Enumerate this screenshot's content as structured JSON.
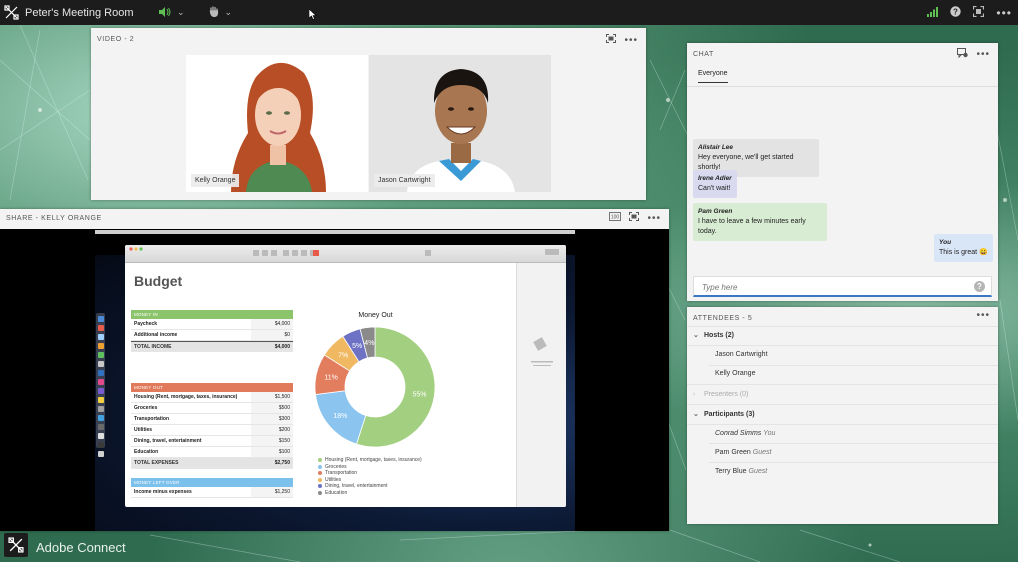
{
  "app": {
    "name": "Adobe Connect",
    "room_title": "Peter's Meeting Room"
  },
  "topbar": {
    "audio_icon": "speaker-icon",
    "raise_hand_icon": "hand-icon",
    "signal_icon": "signal-bars-icon",
    "help_icon": "help-icon",
    "fullscreen_icon": "fullscreen-icon",
    "more_icon": "more-icon"
  },
  "video_pod": {
    "title": "VIDEO - 2",
    "tiles": [
      {
        "name": "Kelly Orange"
      },
      {
        "name": "Jason Cartwright"
      }
    ]
  },
  "share_pod": {
    "title": "SHARE - KELLY ORANGE",
    "zoom_label": "100"
  },
  "budget": {
    "title": "Budget",
    "money_in": {
      "header": "MONEY IN",
      "rows": [
        {
          "label": "Paycheck",
          "value": "$4,000"
        },
        {
          "label": "Additional income",
          "value": "$0"
        }
      ],
      "total": {
        "label": "TOTAL INCOME",
        "value": "$4,000"
      }
    },
    "money_out": {
      "header": "MONEY OUT",
      "rows": [
        {
          "label": "Housing (Rent, mortgage, taxes, insurance)",
          "value": "$1,500"
        },
        {
          "label": "Groceries",
          "value": "$500"
        },
        {
          "label": "Transportation",
          "value": "$300"
        },
        {
          "label": "Utilities",
          "value": "$200"
        },
        {
          "label": "Dining, travel, entertainment",
          "value": "$150"
        },
        {
          "label": "Education",
          "value": "$100"
        }
      ],
      "total": {
        "label": "TOTAL EXPENSES",
        "value": "$2,750"
      }
    },
    "money_left": {
      "header": "MONEY LEFT OVER",
      "rows": [
        {
          "label": "Income minus expenses",
          "value": "$1,250"
        }
      ]
    }
  },
  "chart_data": {
    "type": "pie",
    "title": "Money Out",
    "donut": true,
    "categories": [
      "Housing (Rent, mortgage, taxes, insurance)",
      "Groceries",
      "Transportation",
      "Utilities",
      "Dining, travel, entertainment",
      "Education"
    ],
    "values": [
      55,
      18,
      11,
      7,
      5,
      4
    ],
    "labels": [
      "55%",
      "18%",
      "11%",
      "7%",
      "5%",
      "4%"
    ],
    "colors": [
      "#a3cf80",
      "#8ac4ef",
      "#e27d5e",
      "#f0b861",
      "#6e72c4",
      "#8a8a8a"
    ],
    "legend": "bottom"
  },
  "chat": {
    "title": "CHAT",
    "tab": "Everyone",
    "messages": [
      {
        "author": "Alistair Lee",
        "text": "Hey everyone, we'll get started shortly!",
        "color": "#e3e3e3"
      },
      {
        "author": "Irene Adler",
        "text": "Can't wait!",
        "color": "#d9daf0"
      },
      {
        "author": "Pam Green",
        "text": "I have to leave a few minutes early today.",
        "color": "#d7ecd2"
      },
      {
        "author": "You",
        "text": "This is great 😀",
        "color": "#d9e6f7"
      }
    ],
    "input_placeholder": "Type here"
  },
  "attendees": {
    "title": "ATTENDEES - 5",
    "hosts": {
      "label": "Hosts (2)",
      "people": [
        {
          "name": "Jason Cartwright"
        },
        {
          "name": "Kelly Orange"
        }
      ]
    },
    "presenters": {
      "label": "Presenters (0)"
    },
    "participants": {
      "label": "Participants (3)",
      "people": [
        {
          "name": "Conrad Simms",
          "role": "You"
        },
        {
          "name": "Pam Green",
          "role": "Guest"
        },
        {
          "name": "Terry Blue",
          "role": "Guest"
        }
      ]
    }
  }
}
